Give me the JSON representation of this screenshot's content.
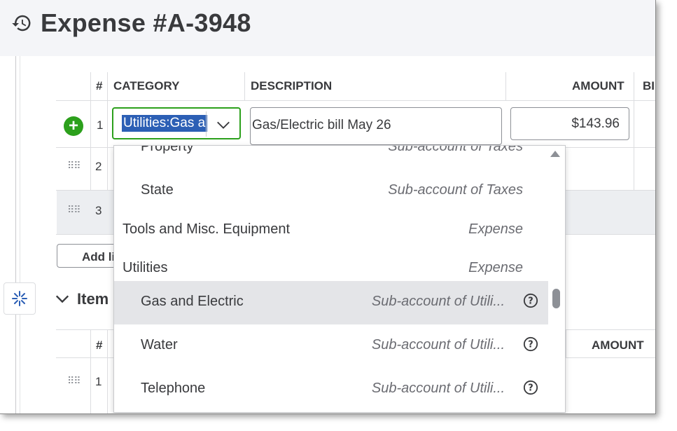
{
  "header": {
    "title": "Expense #A-3948"
  },
  "table": {
    "columns": {
      "num": "#",
      "category": "CATEGORY",
      "description": "DESCRIPTION",
      "amount": "AMOUNT",
      "billable": "BI"
    },
    "rows": [
      {
        "num": "1",
        "category": "Utilities:Gas a",
        "description": "Gas/Electric bill May 26",
        "amount": "$143.96"
      },
      {
        "num": "2"
      },
      {
        "num": "3"
      }
    ],
    "add_lines_label": "Add li"
  },
  "item_section": {
    "title": "Item",
    "columns": {
      "num": "#",
      "amount": "AMOUNT"
    },
    "rows": [
      {
        "num": "1"
      }
    ]
  },
  "dropdown": {
    "options": [
      {
        "label": "Property",
        "type": "Sub-account of Taxes",
        "indent": true
      },
      {
        "label": "State",
        "type": "Sub-account of Taxes",
        "indent": true
      },
      {
        "label": "Tools and Misc. Equipment",
        "type": "Expense",
        "indent": false
      },
      {
        "label": "Utilities",
        "type": "Expense",
        "indent": false
      },
      {
        "label": "Gas and Electric",
        "type": "Sub-account of Utili...",
        "indent": true,
        "selected": true,
        "help": true
      },
      {
        "label": "Water",
        "type": "Sub-account of Utili...",
        "indent": true,
        "help": true
      },
      {
        "label": "Telephone",
        "type": "Sub-account of Utili...",
        "indent": true,
        "help": true
      }
    ]
  },
  "colors": {
    "accent_green": "#2ca01c",
    "selection_blue": "#2c5fb5",
    "text": "#393a3d",
    "selected_row": "#e4e5e8"
  }
}
